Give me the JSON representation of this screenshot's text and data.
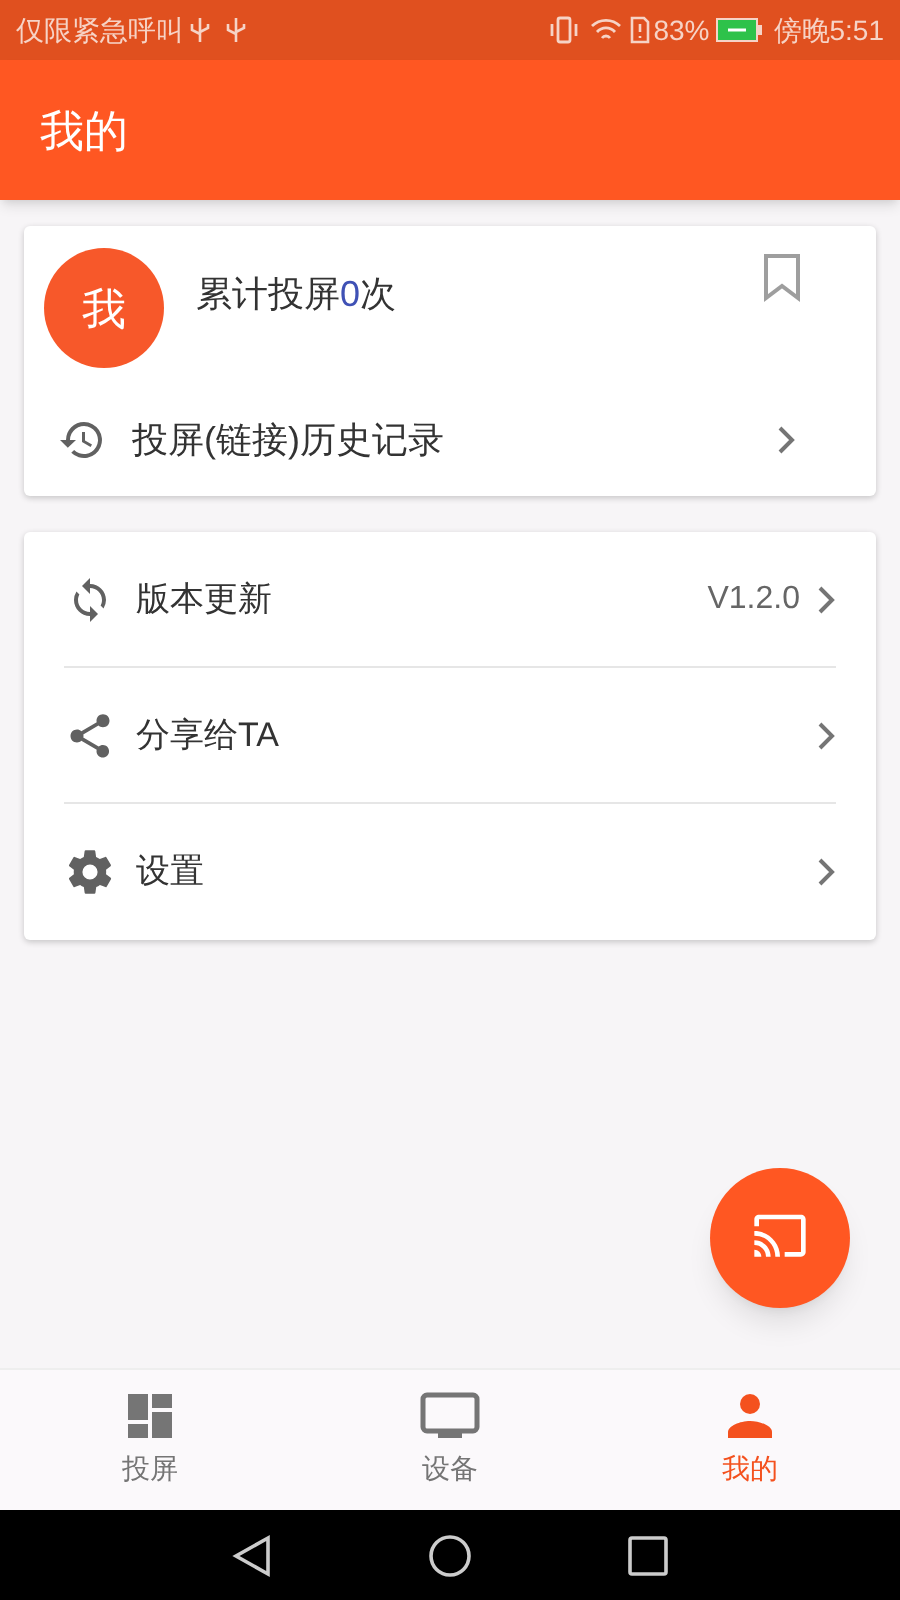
{
  "status_bar": {
    "carrier": "仅限紧急呼叫",
    "battery": "83%",
    "time": "傍晚5:51"
  },
  "app_bar": {
    "title": "我的"
  },
  "profile": {
    "avatar": "我",
    "count_prefix": "累计投屏",
    "count": "0",
    "count_suffix": "次",
    "history": "投屏(链接)历史记录"
  },
  "menu": [
    {
      "label": "版本更新",
      "value": "V1.2.0"
    },
    {
      "label": "分享给TA"
    },
    {
      "label": "设置"
    }
  ],
  "tabs": [
    {
      "label": "投屏",
      "selected": false
    },
    {
      "label": "设备",
      "selected": false
    },
    {
      "label": "我的",
      "selected": true
    }
  ]
}
